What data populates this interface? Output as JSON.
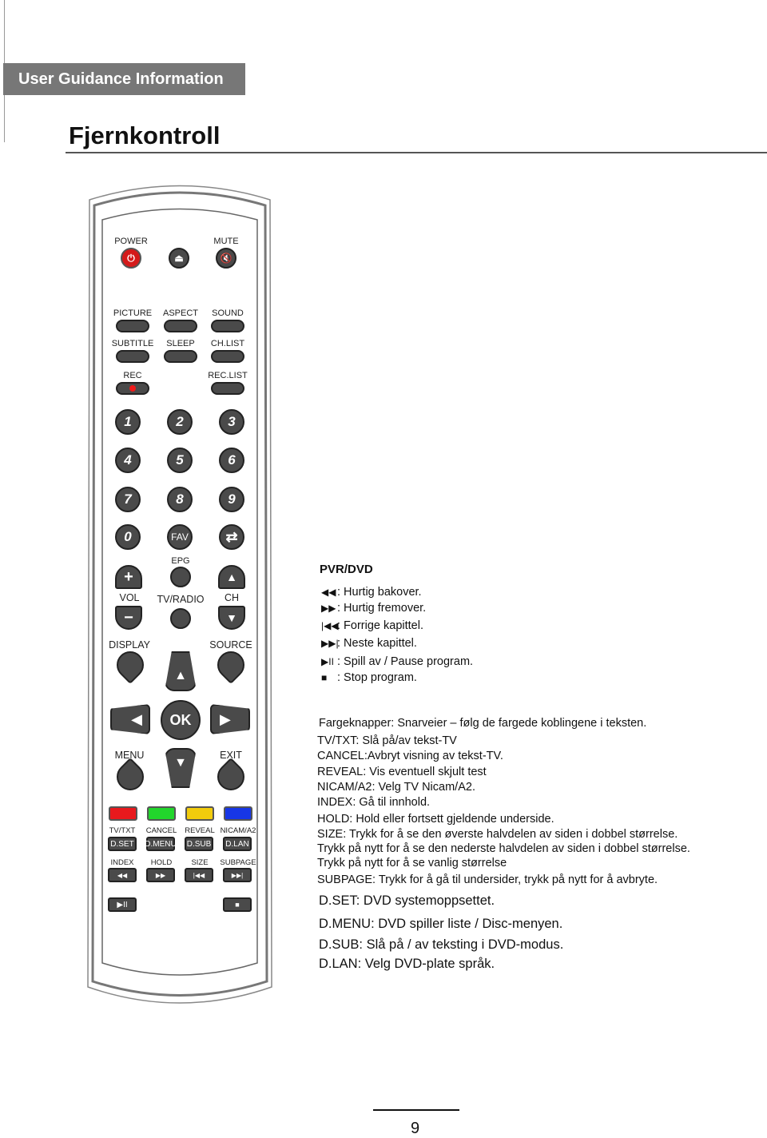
{
  "header": {
    "banner": "User Guidance Information",
    "title": "Fjernkontroll"
  },
  "remote": {
    "top": {
      "power": "POWER",
      "mute": "MUTE"
    },
    "row1": [
      "PICTURE",
      "ASPECT",
      "SOUND"
    ],
    "row2": [
      "SUBTITLE",
      "SLEEP",
      "CH.LIST"
    ],
    "row3": {
      "rec": "REC",
      "reclist": "REC.LIST"
    },
    "numbers": [
      "1",
      "2",
      "3",
      "4",
      "5",
      "6",
      "7",
      "8",
      "9",
      "0"
    ],
    "fav": "FAV",
    "epg": "EPG",
    "vol": "VOL",
    "tvradio": "TV/RADIO",
    "ch": "CH",
    "display": "DISPLAY",
    "source": "SOURCE",
    "ok": "OK",
    "menu": "MENU",
    "exit": "EXIT",
    "colors": [
      "#e8191d",
      "#22d62c",
      "#f2cc0c",
      "#1736e6"
    ],
    "teletext_labels": [
      "TV/TXT",
      "CANCEL",
      "REVEAL",
      "NICAM/A2"
    ],
    "dvd_buttons": [
      "D.SET",
      "D.MENU",
      "D.SUB",
      "D.LAN"
    ],
    "transport_labels": [
      "INDEX",
      "HOLD",
      "SIZE",
      "SUBPAGE"
    ],
    "transport_icons": [
      "◀◀",
      "▶▶",
      "|◀◀",
      "▶▶|"
    ],
    "playpause_icon": "▶II",
    "stop_icon": "■"
  },
  "pvr": {
    "title": "PVR/DVD",
    "items": [
      {
        "icon": "◀◀",
        "text": ": Hurtig bakover."
      },
      {
        "icon": "▶▶",
        "text": ": Hurtig fremover."
      },
      {
        "icon": "|◀◀",
        "text": ": Forrige kapittel."
      },
      {
        "icon": "▶▶|",
        "text": ": Neste kapittel."
      },
      {
        "icon": "▶II",
        "text": ": Spill av / Pause program."
      },
      {
        "icon": "■",
        "text": ": Stop program."
      }
    ]
  },
  "descriptions": [
    "Fargeknapper: Snarveier – følg de fargede koblingene i teksten.",
    "TV/TXT: Slå på/av tekst-TV",
    "CANCEL:Avbryt visning av tekst-TV.",
    "REVEAL:  Vis eventuell skjult test",
    "NICAM/A2: Velg TV Nicam/A2.",
    "INDEX: Gå til innhold.",
    "HOLD: Hold eller fortsett gjeldende underside.",
    "SIZE: Trykk for å se den øverste halvdelen av siden i dobbel størrelse.",
    "Trykk på nytt for å se den nederste halvdelen av siden i dobbel størrelse.",
    "Trykk på nytt for å se vanlig størrelse",
    "SUBPAGE: Trykk for å gå til undersider, trykk på nytt for å avbryte."
  ],
  "dvd_descriptions": [
    "D.SET:  DVD systemoppsettet.",
    "D.MENU:  DVD spiller liste / Disc-menyen.",
    "D.SUB:   Slå på / av teksting i DVD-modus.",
    "D.LAN:   Velg DVD-plate språk."
  ],
  "footer": {
    "page_number": "9"
  }
}
